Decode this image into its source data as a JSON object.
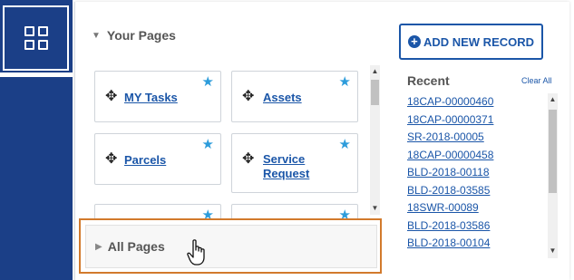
{
  "nav": {
    "app_icon": "grid-icon"
  },
  "your_pages": {
    "label": "Your Pages",
    "toggle_icon": "triangle-down-icon",
    "tiles": [
      {
        "label": "MY Tasks",
        "starred": true
      },
      {
        "label": "Assets",
        "starred": true
      },
      {
        "label": "Parcels",
        "starred": true
      },
      {
        "label_line1": "Service",
        "label_line2": "Request",
        "starred": true
      }
    ]
  },
  "all_pages": {
    "label": "All Pages",
    "toggle_icon": "triangle-right-icon"
  },
  "add_record": {
    "label": "ADD NEW RECORD",
    "icon": "plus-circle-icon"
  },
  "recent": {
    "title": "Recent",
    "clear_label": "Clear All",
    "items": [
      "18CAP-00000460",
      "18CAP-00000371",
      "SR-2018-00005",
      "18CAP-00000458",
      "BLD-2018-00118",
      "BLD-2018-03585",
      "18SWR-00089",
      "BLD-2018-03586",
      "BLD-2018-00104"
    ]
  },
  "colors": {
    "nav": "#1b3f87",
    "link": "#1b56a8",
    "star": "#2d9cdb",
    "highlight": "#d27a2c"
  }
}
